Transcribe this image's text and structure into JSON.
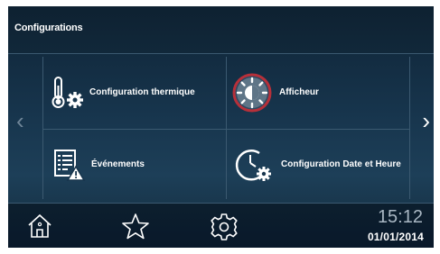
{
  "header": {
    "title": "Configurations"
  },
  "tiles": [
    {
      "label": "Configuration thermique",
      "icon": "thermometer-gear-icon"
    },
    {
      "label": "Afficheur",
      "icon": "brightness-icon"
    },
    {
      "label": "Événements",
      "icon": "event-log-warning-icon"
    },
    {
      "label": "Configuration  Date  et Heure",
      "icon": "clock-gear-icon"
    }
  ],
  "nav": {
    "left": "‹",
    "right": "›"
  },
  "bottom": {
    "time": "15:12",
    "date": "01/01/2014"
  },
  "colors": {
    "accent_ring": "#b6303a",
    "background": "#17354d"
  }
}
